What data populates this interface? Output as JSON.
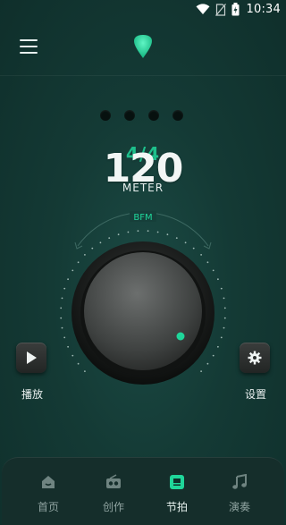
{
  "status_bar": {
    "time": "10:34"
  },
  "metronome": {
    "time_signature": "4/4",
    "tempo": "120",
    "meter_label": "METER",
    "dial_label": "BFM",
    "beats": 4,
    "accent_color": "#1fd69a"
  },
  "controls": {
    "play_label": "播放",
    "settings_label": "设置"
  },
  "bottom_nav": {
    "items": [
      {
        "label": "首页",
        "icon": "home-icon"
      },
      {
        "label": "创作",
        "icon": "radio-icon"
      },
      {
        "label": "节拍",
        "icon": "metronome-icon",
        "active": true
      },
      {
        "label": "演奏",
        "icon": "music-note-icon"
      }
    ]
  }
}
